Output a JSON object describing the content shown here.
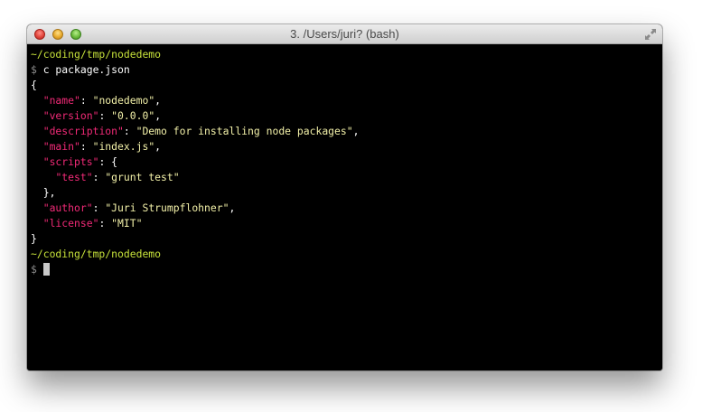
{
  "window": {
    "title": "3. /Users/juri? (bash)"
  },
  "colors": {
    "prompt_path": "#c6e13a",
    "json_key": "#f12a77",
    "json_string": "#f2f0a8",
    "text": "#ffffff",
    "background": "#000000"
  },
  "terminal": {
    "prompt1": "~/coding/tmp/nodedemo",
    "dollar": "$",
    "command": " c package.json",
    "open_brace": "{",
    "indent": "  ",
    "indent2": "    ",
    "quote": "\"",
    "colon_space": ": ",
    "comma": ",",
    "fields": {
      "name": {
        "key": "name",
        "value": "\"nodedemo\""
      },
      "version": {
        "key": "version",
        "value": "\"0.0.0\""
      },
      "description": {
        "key": "description",
        "value": "\"Demo for installing node packages\""
      },
      "main": {
        "key": "main",
        "value": "\"index.js\""
      },
      "scripts": {
        "key": "scripts",
        "open": "{"
      },
      "test": {
        "key": "test",
        "value": "\"grunt test\""
      },
      "scripts_close": "},",
      "author": {
        "key": "author",
        "value": "\"Juri Strumpflohner\""
      },
      "license": {
        "key": "license",
        "value": "\"MIT\""
      }
    },
    "close_brace": "}",
    "prompt2": "~/coding/tmp/nodedemo",
    "cursor_space": " "
  }
}
